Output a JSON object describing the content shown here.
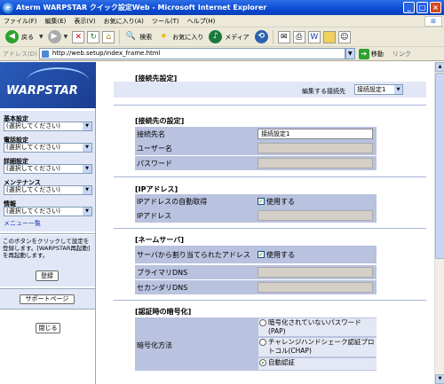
{
  "window": {
    "title": "Aterm WARPSTAR クイック設定Web - Microsoft Internet Explorer",
    "min": "_",
    "max": "□",
    "close": "×"
  },
  "menu": [
    "ファイル(F)",
    "編集(E)",
    "表示(V)",
    "お気に入り(A)",
    "ツール(T)",
    "ヘルプ(H)"
  ],
  "toolbar": {
    "back": "戻る",
    "search": "検索",
    "favorites": "お気に入り",
    "media": "メディア"
  },
  "address": {
    "label": "アドレス(D)",
    "url": "http://web.setup/index_frame.html",
    "go": "移動",
    "links": "リンク"
  },
  "left": {
    "logo": "WARPSTAR",
    "groups": [
      {
        "label": "基本設定",
        "value": "(選択してください)"
      },
      {
        "label": "電話設定",
        "value": "(選択してください)"
      },
      {
        "label": "詳細設定",
        "value": "(選択してください)"
      },
      {
        "label": "メンテナンス",
        "value": "(選択してください)"
      },
      {
        "label": "情報",
        "value": "(選択してください)"
      }
    ],
    "menu_list": "メニュー一覧",
    "info_text": "このボタンをクリックして設定を登録します。[WARPSTAR再起動]を再起動します。",
    "register": "登録",
    "support": "サポートページ",
    "close": "閉じる"
  },
  "main": {
    "heading": "[接続先設定]",
    "target_label": "編集する接続先",
    "target_value": "接続設定1",
    "sec_connection": "[接続先の設定]",
    "conn_name_label": "接続先名",
    "conn_name_value": "接続設定1",
    "user_label": "ユーザー名",
    "password_label": "パスワード",
    "sec_ip": "[IPアドレス]",
    "ip_auto_label": "IPアドレスの自動取得",
    "ip_auto_check": "使用する",
    "ip_label": "IPアドレス",
    "sec_dns": "[ネームサーバ]",
    "dns_auto_label": "サーバから割り当てられたアドレス",
    "dns_auto_check": "使用する",
    "dns_primary": "プライマリDNS",
    "dns_secondary": "セカンダリDNS",
    "sec_auth": "[認証時の暗号化]",
    "enc_label": "暗号化方法",
    "enc_opt1": "暗号化されていないパスワード(PAP)",
    "enc_opt2": "チャレンジハンドシェーク認証プロトコル(CHAP)",
    "enc_opt3": "自動認証"
  }
}
